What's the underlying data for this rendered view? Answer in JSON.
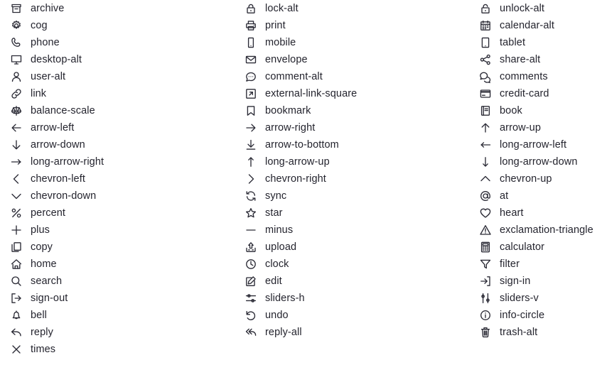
{
  "page": {
    "title": "Icon Gallery",
    "background_color": "#ffffff",
    "text_color": "#24242e",
    "icon_color": "#2b2b36",
    "column_count": 3,
    "rows_per_column": 21,
    "total_icons": 63
  },
  "columns": [
    {
      "index": 0,
      "items": [
        {
          "icon": "archive-icon",
          "label": "archive"
        },
        {
          "icon": "cog-icon",
          "label": "cog"
        },
        {
          "icon": "phone-icon",
          "label": "phone"
        },
        {
          "icon": "desktop-alt-icon",
          "label": "desktop-alt"
        },
        {
          "icon": "user-alt-icon",
          "label": "user-alt"
        },
        {
          "icon": "link-icon",
          "label": "link"
        },
        {
          "icon": "balance-scale-icon",
          "label": "balance-scale"
        },
        {
          "icon": "arrow-left-icon",
          "label": "arrow-left"
        },
        {
          "icon": "arrow-down-icon",
          "label": "arrow-down"
        },
        {
          "icon": "long-arrow-right-icon",
          "label": "long-arrow-right"
        },
        {
          "icon": "chevron-left-icon",
          "label": "chevron-left"
        },
        {
          "icon": "chevron-down-icon",
          "label": "chevron-down"
        },
        {
          "icon": "percent-icon",
          "label": "percent"
        },
        {
          "icon": "plus-icon",
          "label": "plus"
        },
        {
          "icon": "copy-icon",
          "label": "copy"
        },
        {
          "icon": "home-icon",
          "label": "home"
        },
        {
          "icon": "search-icon",
          "label": "search"
        },
        {
          "icon": "sign-out-icon",
          "label": "sign-out"
        },
        {
          "icon": "bell-icon",
          "label": "bell"
        },
        {
          "icon": "reply-icon",
          "label": "reply"
        },
        {
          "icon": "times-icon",
          "label": "times"
        }
      ]
    },
    {
      "index": 1,
      "items": [
        {
          "icon": "lock-alt-icon",
          "label": "lock-alt"
        },
        {
          "icon": "print-icon",
          "label": "print"
        },
        {
          "icon": "mobile-icon",
          "label": "mobile"
        },
        {
          "icon": "envelope-icon",
          "label": "envelope"
        },
        {
          "icon": "comment-alt-icon",
          "label": "comment-alt"
        },
        {
          "icon": "external-link-square-icon",
          "label": "external-link-square"
        },
        {
          "icon": "bookmark-icon",
          "label": "bookmark"
        },
        {
          "icon": "arrow-right-icon",
          "label": "arrow-right"
        },
        {
          "icon": "arrow-to-bottom-icon",
          "label": "arrow-to-bottom"
        },
        {
          "icon": "long-arrow-up-icon",
          "label": "long-arrow-up"
        },
        {
          "icon": "chevron-right-icon",
          "label": "chevron-right"
        },
        {
          "icon": "sync-icon",
          "label": "sync"
        },
        {
          "icon": "star-icon",
          "label": "star"
        },
        {
          "icon": "minus-icon",
          "label": "minus"
        },
        {
          "icon": "upload-icon",
          "label": "upload"
        },
        {
          "icon": "clock-icon",
          "label": "clock"
        },
        {
          "icon": "edit-icon",
          "label": "edit"
        },
        {
          "icon": "sliders-h-icon",
          "label": "sliders-h"
        },
        {
          "icon": "undo-icon",
          "label": "undo"
        },
        {
          "icon": "reply-all-icon",
          "label": "reply-all"
        }
      ]
    },
    {
      "index": 2,
      "items": [
        {
          "icon": "unlock-alt-icon",
          "label": "unlock-alt"
        },
        {
          "icon": "calendar-alt-icon",
          "label": "calendar-alt"
        },
        {
          "icon": "tablet-icon",
          "label": "tablet"
        },
        {
          "icon": "share-alt-icon",
          "label": "share-alt"
        },
        {
          "icon": "comments-icon",
          "label": "comments"
        },
        {
          "icon": "credit-card-icon",
          "label": "credit-card"
        },
        {
          "icon": "book-icon",
          "label": "book"
        },
        {
          "icon": "arrow-up-icon",
          "label": "arrow-up"
        },
        {
          "icon": "long-arrow-left-icon",
          "label": "long-arrow-left"
        },
        {
          "icon": "long-arrow-down-icon",
          "label": "long-arrow-down"
        },
        {
          "icon": "chevron-up-icon",
          "label": "chevron-up"
        },
        {
          "icon": "at-icon",
          "label": "at"
        },
        {
          "icon": "heart-icon",
          "label": "heart"
        },
        {
          "icon": "exclamation-triangle-icon",
          "label": "exclamation-triangle"
        },
        {
          "icon": "calculator-icon",
          "label": "calculator"
        },
        {
          "icon": "filter-icon",
          "label": "filter"
        },
        {
          "icon": "sign-in-icon",
          "label": "sign-in"
        },
        {
          "icon": "sliders-v-icon",
          "label": "sliders-v"
        },
        {
          "icon": "info-circle-icon",
          "label": "info-circle"
        },
        {
          "icon": "trash-alt-icon",
          "label": "trash-alt"
        }
      ]
    }
  ]
}
